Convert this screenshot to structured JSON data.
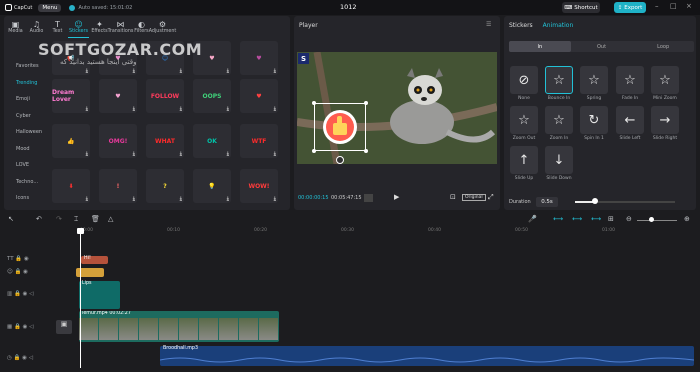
{
  "app": {
    "name": "CapCut",
    "menu_label": "Menu",
    "autosave": "Auto saved: 15:01:02",
    "project_title": "1012",
    "shortcut_label": "Shortcut",
    "export_label": "Export"
  },
  "toolbar": {
    "tabs": [
      "Media",
      "Audio",
      "Text",
      "Stickers",
      "Effects",
      "Transitions",
      "Filters",
      "Adjustment"
    ]
  },
  "watermark": {
    "main": "SOFTGOZAR.COM",
    "sub": "وقتی اینجا هستید بدانید که"
  },
  "stickers": {
    "categories": [
      "Favorites",
      "Trending",
      "Emoji",
      "Cyber",
      "Halloween",
      "Mood",
      "LOVE",
      "Techno...",
      "Icons"
    ],
    "active_category": "Trending",
    "items": [
      {
        "label": "📢",
        "color": "#ff9933"
      },
      {
        "label": "♥",
        "color": "#e68cc9"
      },
      {
        "label": "😊",
        "color": "#2b7dd2"
      },
      {
        "label": "♥",
        "color": "#f7a8c8"
      },
      {
        "label": "♥",
        "color": "#b94da0"
      },
      {
        "label": "Dream Lover",
        "color": "#ff7ad1"
      },
      {
        "label": "♥",
        "color": "#f4a2d0"
      },
      {
        "label": "FOLLOW",
        "color": "#ff3b5c"
      },
      {
        "label": "OOPS",
        "color": "#3fd17a"
      },
      {
        "label": "♥",
        "color": "#ff4040"
      },
      {
        "label": "👍",
        "color": "#ff5c4f"
      },
      {
        "label": "OMG!",
        "color": "#e6399b"
      },
      {
        "label": "WHAT",
        "color": "#ff2b2b"
      },
      {
        "label": "OK",
        "color": "#00c2a8"
      },
      {
        "label": "WTF",
        "color": "#ff2b2b"
      },
      {
        "label": "⬇",
        "color": "#ff3030"
      },
      {
        "label": "!",
        "color": "#ff6a6a"
      },
      {
        "label": "?",
        "color": "#ffe135"
      },
      {
        "label": "💡",
        "color": "#ffe135"
      },
      {
        "label": "WOW!",
        "color": "#ff3b3b"
      }
    ]
  },
  "player": {
    "title": "Player",
    "current_time": "00:00:00:15",
    "total_time": "00:05:47:15",
    "ratio_label": "Original"
  },
  "props": {
    "tabs": [
      "Stickers",
      "Animation"
    ],
    "segments": [
      "In",
      "Out",
      "Loop"
    ],
    "animations": [
      "None",
      "Bounce In",
      "Spring",
      "Fade In",
      "Mini Zoom",
      "Zoom Out",
      "Zoom In",
      "Spin In 1",
      "Slide Left",
      "Slide Right",
      "Slide Up",
      "Slide Down"
    ],
    "animation_icons": [
      "⊘",
      "☆",
      "☆",
      "☆",
      "☆",
      "☆",
      "☆",
      "↻",
      "←",
      "→",
      "↑",
      "↓"
    ],
    "duration_label": "Duration",
    "duration_value": "0.5s",
    "duration_fraction": 0.2
  },
  "timeline": {
    "ruler": [
      "00:00",
      "00:10",
      "00:20",
      "00:30",
      "00:40",
      "00:50",
      "01:00"
    ],
    "clips": {
      "text_label": "Hi!",
      "text2_label": "",
      "effect_label": "Lips",
      "video_label": "lemur.mp4  00:02:27",
      "audio_label": "Broodhall.mp3"
    }
  }
}
